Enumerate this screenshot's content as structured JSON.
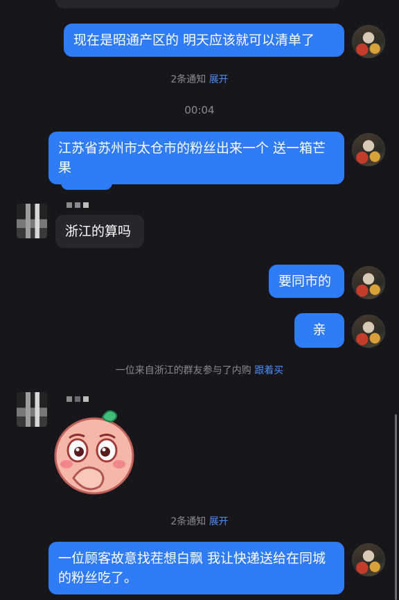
{
  "messages": {
    "m1": "现在是昭通产区的 明天应该就可以清单了",
    "notice1_text": "2条通知",
    "notice1_link": "展开",
    "time": "00:04",
    "m2": "江苏省苏州市太仓市的粉丝出来一个 送一箱芒果",
    "m3": "浙江的算吗",
    "m4": "要同市的",
    "m5": "亲",
    "system_text": "一位来自浙江的群友参与了内购",
    "system_link": "跟着买",
    "notice2_text": "2条通知",
    "notice2_link": "展开",
    "m6": "一位顾客故意找茬想白飘 我让快递送给在同城的粉丝吃了。"
  },
  "colors": {
    "background": "#17171b",
    "self_bubble": "#2f7cf6",
    "other_bubble": "#26262c",
    "link": "#4e8df7"
  },
  "icons": [
    "self-avatar-icon",
    "contact-avatar-icon",
    "peach-sticker-icon"
  ]
}
